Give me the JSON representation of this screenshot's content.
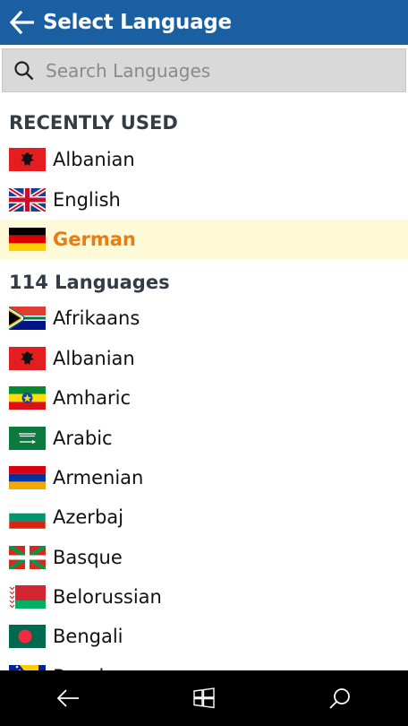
{
  "header": {
    "title": "Select Language"
  },
  "search": {
    "placeholder": "Search Languages"
  },
  "recent": {
    "title": "RECENTLY USED",
    "items": [
      {
        "name": "Albanian",
        "flag": "albania-flag"
      },
      {
        "name": "English",
        "flag": "uk-flag"
      },
      {
        "name": "German",
        "flag": "germany-flag",
        "selected": true
      }
    ]
  },
  "all": {
    "title": "114 Languages",
    "items": [
      {
        "name": "Afrikaans",
        "flag": "south-africa-flag"
      },
      {
        "name": "Albanian",
        "flag": "albania-flag"
      },
      {
        "name": "Amharic",
        "flag": "ethiopia-flag"
      },
      {
        "name": "Arabic",
        "flag": "saudi-arabia-flag"
      },
      {
        "name": "Armenian",
        "flag": "armenia-flag"
      },
      {
        "name": "Azerbaj",
        "flag": "bulgaria-style-flag"
      },
      {
        "name": "Basque",
        "flag": "basque-flag"
      },
      {
        "name": "Belorussian",
        "flag": "belarus-flag"
      },
      {
        "name": "Bengali",
        "flag": "bangladesh-flag"
      },
      {
        "name": "Bosnian",
        "flag": "bosnia-flag"
      }
    ]
  },
  "colors": {
    "accent": "#1b5fa3",
    "selected_bg": "#fefad8",
    "selected_text": "#e87e13"
  },
  "taskbar": {
    "icons": [
      "back-icon",
      "windows-icon",
      "search-icon"
    ]
  }
}
